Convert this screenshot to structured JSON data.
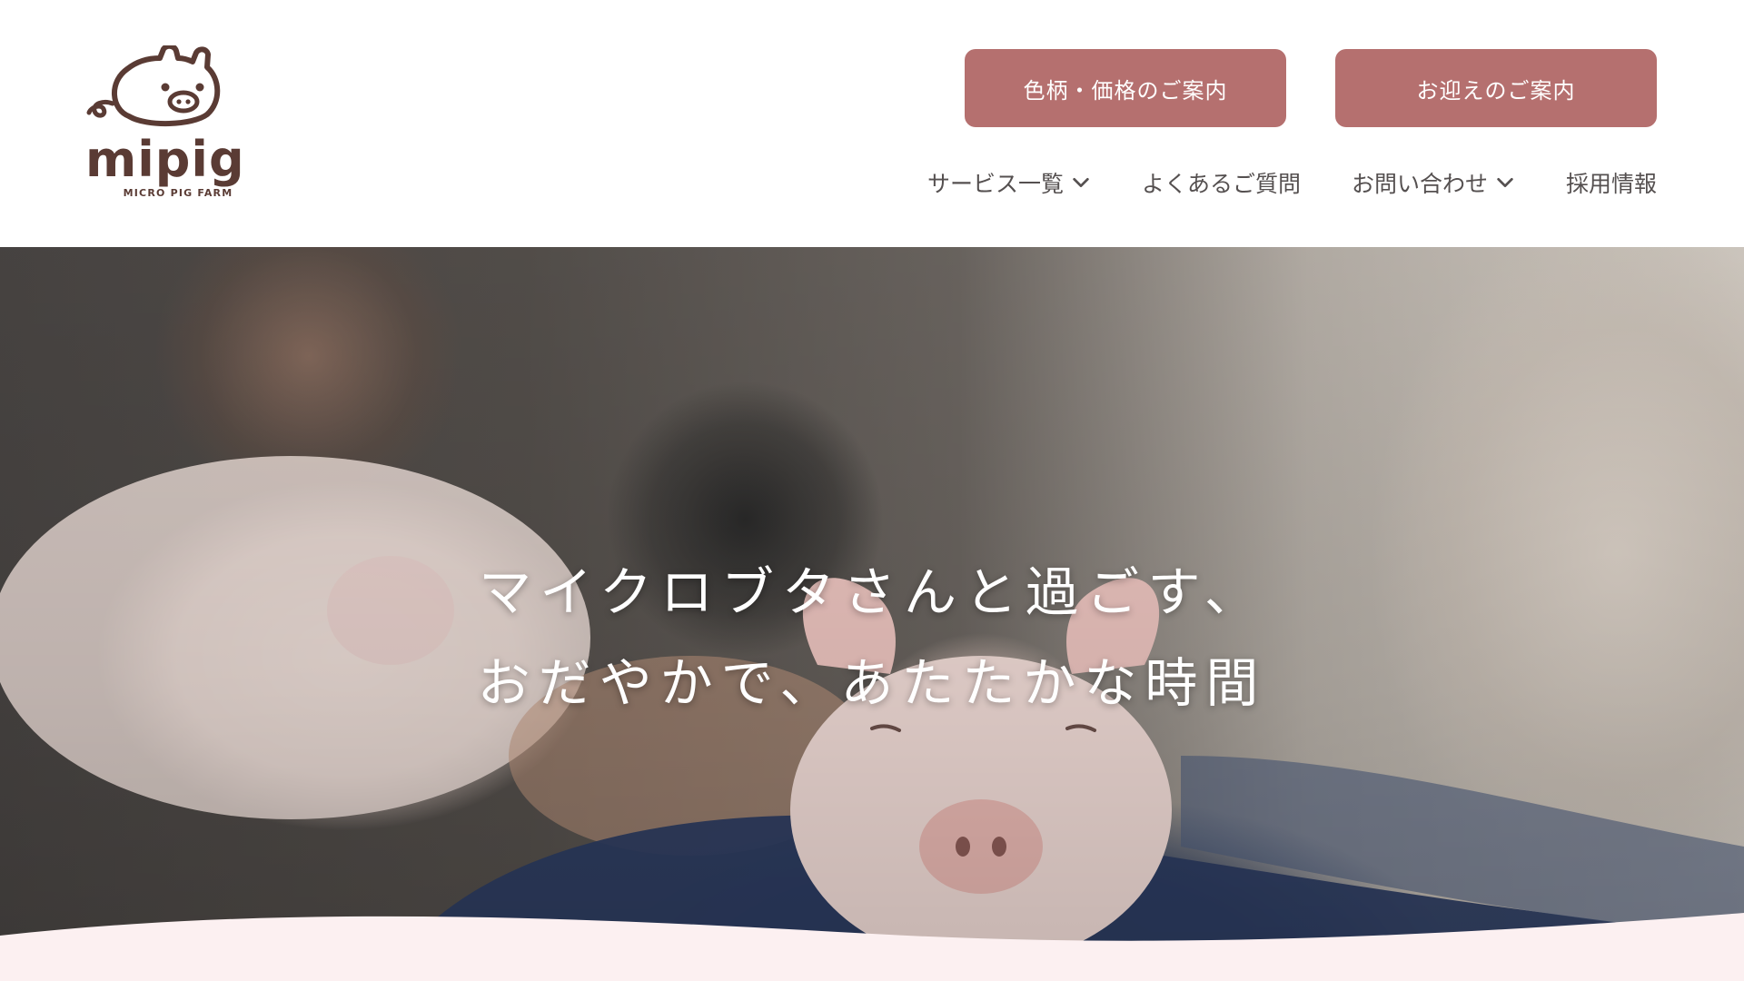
{
  "logo": {
    "wordmark": "mipig",
    "tagline": "MICRO PIG FARM",
    "icon": "pig-face-icon"
  },
  "buttons": {
    "colors_prices": "色柄・価格のご案内",
    "welcome": "お迎えのご案内"
  },
  "nav": {
    "items": [
      {
        "label": "サービス一覧",
        "has_dropdown": true
      },
      {
        "label": "よくあるご質問",
        "has_dropdown": false
      },
      {
        "label": "お問い合わせ",
        "has_dropdown": true
      },
      {
        "label": "採用情報",
        "has_dropdown": false
      }
    ]
  },
  "hero": {
    "headline_line1": "マイクロブタさんと過ごす、",
    "headline_line2": "おだやかで、あたたかな時間"
  },
  "colors": {
    "brand_brown": "#5a3b34",
    "button_rose": "#b5706f",
    "nav_text": "#555050",
    "wave_pink": "#fcf0f1"
  }
}
